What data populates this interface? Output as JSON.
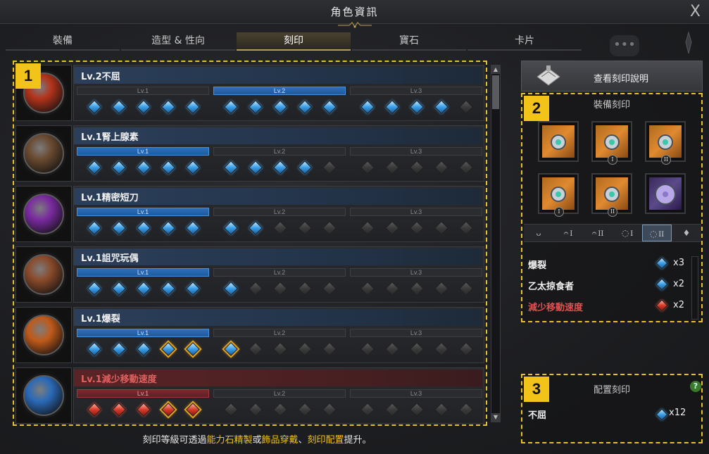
{
  "window": {
    "title": "角色資訊",
    "close_label": "X"
  },
  "tabs": [
    {
      "label": "裝備",
      "active": false
    },
    {
      "label": "造型 & 性向",
      "active": false
    },
    {
      "label": "刻印",
      "active": true
    },
    {
      "label": "寶石",
      "active": false
    },
    {
      "label": "卡片",
      "active": false
    }
  ],
  "badges": {
    "left": "1",
    "equip": "2",
    "config": "3"
  },
  "engravings": [
    {
      "name": "Lv.2不屈",
      "color": "blue",
      "icon_color": "#b3331a",
      "levels": [
        {
          "label": "Lv.1",
          "active": false,
          "gems": [
            "blue",
            "blue",
            "blue",
            "blue",
            "blue"
          ]
        },
        {
          "label": "Lv.2",
          "active": true,
          "gems": [
            "blue",
            "blue",
            "blue",
            "blue",
            "blue"
          ]
        },
        {
          "label": "Lv.3",
          "active": false,
          "gems": [
            "blue",
            "blue",
            "blue",
            "blue",
            "empty"
          ]
        }
      ]
    },
    {
      "name": "Lv.1腎上腺素",
      "color": "blue",
      "icon_color": "#6a4a30",
      "levels": [
        {
          "label": "Lv.1",
          "active": true,
          "gems": [
            "blue",
            "blue",
            "blue",
            "blue",
            "blue"
          ]
        },
        {
          "label": "Lv.2",
          "active": false,
          "gems": [
            "blue",
            "blue",
            "blue",
            "blue",
            "empty"
          ]
        },
        {
          "label": "Lv.3",
          "active": false,
          "gems": [
            "empty",
            "empty",
            "empty",
            "empty",
            "empty"
          ]
        }
      ]
    },
    {
      "name": "Lv.1精密短刀",
      "color": "blue",
      "icon_color": "#7a2aa0",
      "levels": [
        {
          "label": "Lv.1",
          "active": true,
          "gems": [
            "blue",
            "blue",
            "blue",
            "blue",
            "blue"
          ]
        },
        {
          "label": "Lv.2",
          "active": false,
          "gems": [
            "blue",
            "blue",
            "empty",
            "empty",
            "empty"
          ]
        },
        {
          "label": "Lv.3",
          "active": false,
          "gems": [
            "empty",
            "empty",
            "empty",
            "empty",
            "empty"
          ]
        }
      ]
    },
    {
      "name": "Lv.1詛咒玩偶",
      "color": "blue",
      "icon_color": "#8a4a2a",
      "levels": [
        {
          "label": "Lv.1",
          "active": true,
          "gems": [
            "blue",
            "blue",
            "blue",
            "blue",
            "blue"
          ]
        },
        {
          "label": "Lv.2",
          "active": false,
          "gems": [
            "blue",
            "empty",
            "empty",
            "empty",
            "empty"
          ]
        },
        {
          "label": "Lv.3",
          "active": false,
          "gems": [
            "empty",
            "empty",
            "empty",
            "empty",
            "empty"
          ]
        }
      ]
    },
    {
      "name": "Lv.1爆裂",
      "color": "blue",
      "icon_color": "#c05a1a",
      "levels": [
        {
          "label": "Lv.1",
          "active": true,
          "gems": [
            "blue",
            "blue",
            "blue",
            "blue-gold",
            "blue-gold"
          ]
        },
        {
          "label": "Lv.2",
          "active": false,
          "gems": [
            "blue-gold",
            "empty",
            "empty",
            "empty",
            "empty"
          ]
        },
        {
          "label": "Lv.3",
          "active": false,
          "gems": [
            "empty",
            "empty",
            "empty",
            "empty",
            "empty"
          ]
        }
      ]
    },
    {
      "name": "Lv.1減少移動速度",
      "color": "red",
      "icon_color": "#2a6ab8",
      "levels": [
        {
          "label": "Lv.1",
          "active": true,
          "gems": [
            "red",
            "red",
            "red",
            "red-gold",
            "red-gold"
          ]
        },
        {
          "label": "Lv.2",
          "active": false,
          "gems": [
            "empty",
            "empty",
            "empty",
            "empty",
            "empty"
          ]
        },
        {
          "label": "Lv.3",
          "active": false,
          "gems": [
            "empty",
            "empty",
            "empty",
            "empty",
            "empty"
          ]
        }
      ]
    }
  ],
  "footnote": {
    "prefix": "刻印等級可透過",
    "hl1": "能力石精製",
    "mid": "或",
    "hl2": "飾品穿戴",
    "sep": "、",
    "hl3": "刻印配置",
    "suffix": "提升。"
  },
  "right": {
    "view_button": "查看刻印說明",
    "equip_title": "裝備刻印",
    "slots": [
      {
        "icon": "necklace-icon",
        "roman": "",
        "tone": "orange"
      },
      {
        "icon": "earring-icon",
        "roman": "I",
        "tone": "orange"
      },
      {
        "icon": "earring-icon",
        "roman": "II",
        "tone": "orange"
      },
      {
        "icon": "ring-icon",
        "roman": "I",
        "tone": "orange"
      },
      {
        "icon": "ring-icon",
        "roman": "II",
        "tone": "orange"
      },
      {
        "icon": "stone-icon",
        "roman": "",
        "tone": "purple"
      }
    ],
    "filters": [
      {
        "icon": "necklace-filter-icon",
        "label": "",
        "active": false
      },
      {
        "icon": "earring-filter-icon",
        "label": "I",
        "active": false
      },
      {
        "icon": "earring-filter-icon",
        "label": "II",
        "active": false
      },
      {
        "icon": "ring-filter-icon",
        "label": "I",
        "active": false
      },
      {
        "icon": "ring-filter-icon",
        "label": "II",
        "active": true
      },
      {
        "icon": "stone-filter-icon",
        "label": "",
        "active": false
      }
    ],
    "effects": [
      {
        "name": "爆裂",
        "gem": "blue",
        "count": "x3"
      },
      {
        "name": "乙太掠食者",
        "gem": "blue",
        "count": "x2"
      },
      {
        "name": "減少移動速度",
        "gem": "red",
        "count": "x2"
      }
    ],
    "config_title": "配置刻印",
    "help_label": "?",
    "config_items": [
      {
        "name": "不屈",
        "gem": "blue",
        "count": "x12"
      }
    ]
  },
  "colors": {
    "accent_gold": "#e6c12a",
    "active_blue": "#2c6fb8",
    "negative_red": "#e05050"
  }
}
